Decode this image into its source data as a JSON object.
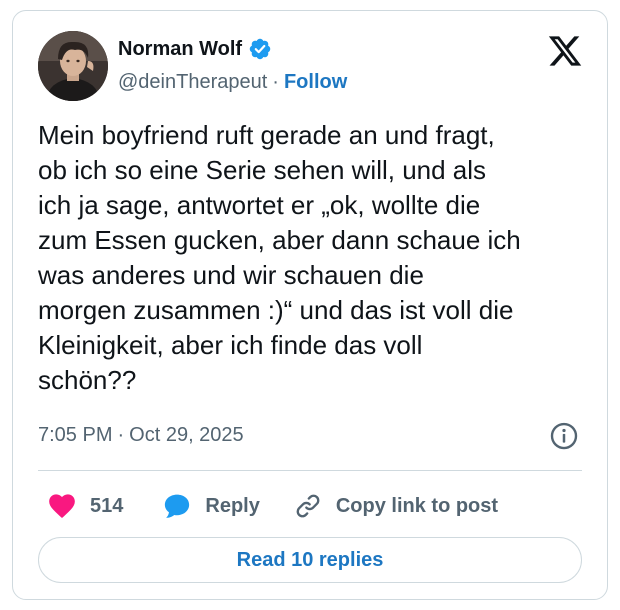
{
  "author": {
    "display_name": "Norman Wolf",
    "handle": "@deinTherapeut",
    "separator": "·",
    "follow_label": "Follow",
    "verified": true
  },
  "tweet": {
    "text": "Mein boyfriend ruft gerade an und fragt,\nob ich so eine Serie sehen will, und als\nich ja sage, antwortet er „ok, wollte die\nzum Essen gucken, aber dann schaue ich\nwas anderes und wir schauen die\nmorgen zusammen :)“ und das ist voll die\nKleinigkeit, aber ich finde das voll\nschön??",
    "time": "7:05 PM",
    "separator": "·",
    "date": "Oct 29, 2025"
  },
  "actions": {
    "like_count": "514",
    "reply_label": "Reply",
    "copy_link_label": "Copy link to post"
  },
  "read_replies_label": "Read 10 replies",
  "icons": {
    "platform_logo": "x-logo-icon",
    "verified": "verified-badge-icon",
    "info": "info-icon",
    "like": "heart-icon",
    "reply": "speech-bubble-icon",
    "copy_link": "link-icon"
  },
  "colors": {
    "text": "#0f1419",
    "secondary_text": "#536471",
    "link": "#1d77c2",
    "verified": "#1d9bf0",
    "like": "#f91880",
    "reply": "#1d9bf0",
    "border": "#cfd9de"
  }
}
